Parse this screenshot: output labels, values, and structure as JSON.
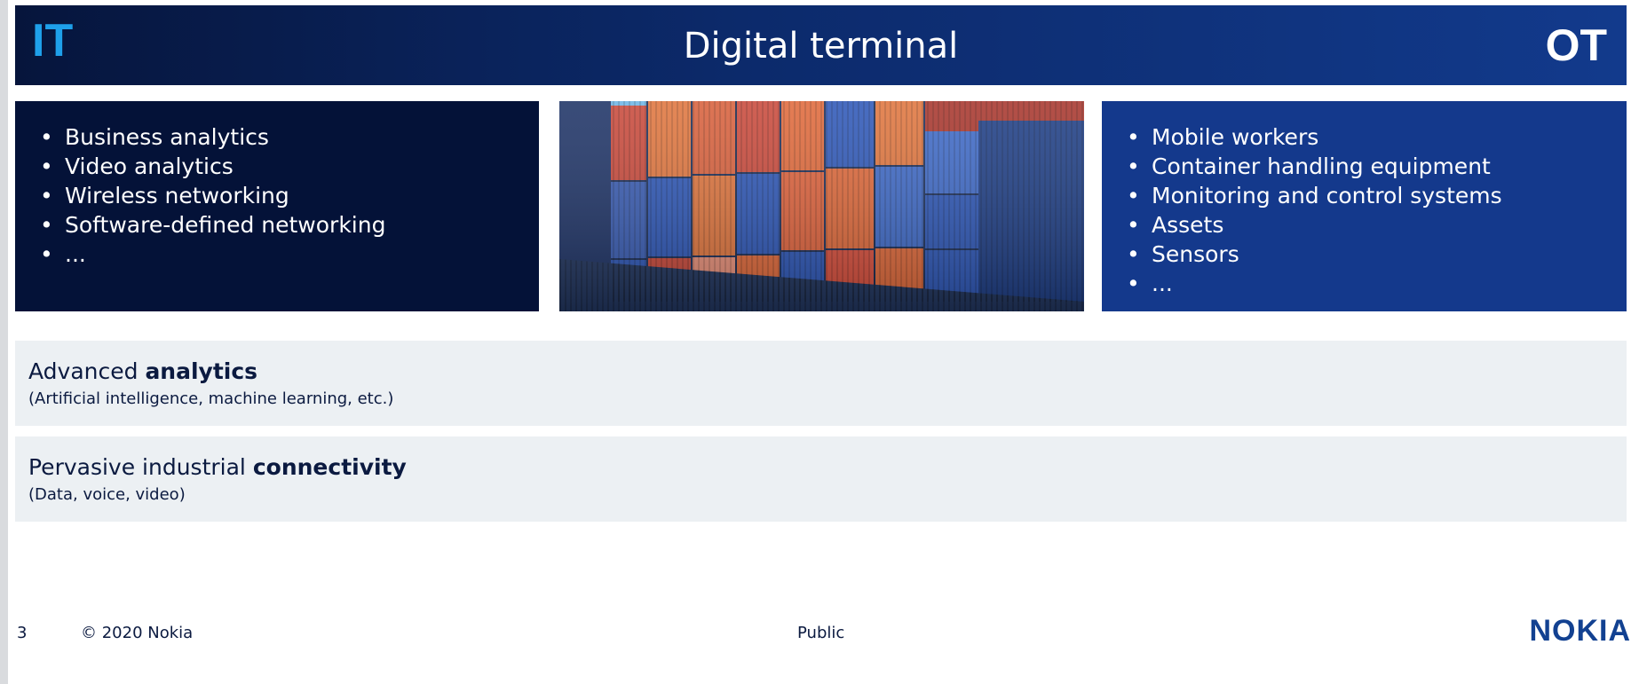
{
  "header": {
    "left_label": "IT",
    "title": "Digital terminal",
    "right_label": "OT"
  },
  "it_panel": {
    "items": [
      "Business analytics",
      "Video analytics",
      "Wireless networking",
      "Software-defined networking",
      "..."
    ]
  },
  "image": {
    "description_icon": "shipping-containers-photo",
    "container_colors": [
      "#c94a3c",
      "#e0763f",
      "#2f58b8",
      "#1f3f86",
      "#d8613d",
      "#3f6ac8"
    ]
  },
  "ot_panel": {
    "items": [
      "Mobile workers",
      "Container handling equipment",
      "Monitoring and control systems",
      "Assets",
      "Sensors",
      "..."
    ]
  },
  "bands": {
    "analytics": {
      "title_prefix": "Advanced ",
      "title_bold": "analytics",
      "subtitle": "(Artificial intelligence, machine learning, etc.)"
    },
    "connectivity": {
      "title_prefix": "Pervasive industrial ",
      "title_bold": "connectivity",
      "subtitle": "(Data, voice, video)"
    }
  },
  "footer": {
    "page_number": "3",
    "copyright": "© 2020 Nokia",
    "classification": "Public",
    "logo": "NOKIA"
  },
  "colors": {
    "header_dark": "#06153c",
    "header_light": "#123a8c",
    "it_accent": "#1ea0ea",
    "it_panel": "#041238",
    "ot_panel": "#14398c",
    "band": "#ecf0f3",
    "logo": "#124191"
  }
}
